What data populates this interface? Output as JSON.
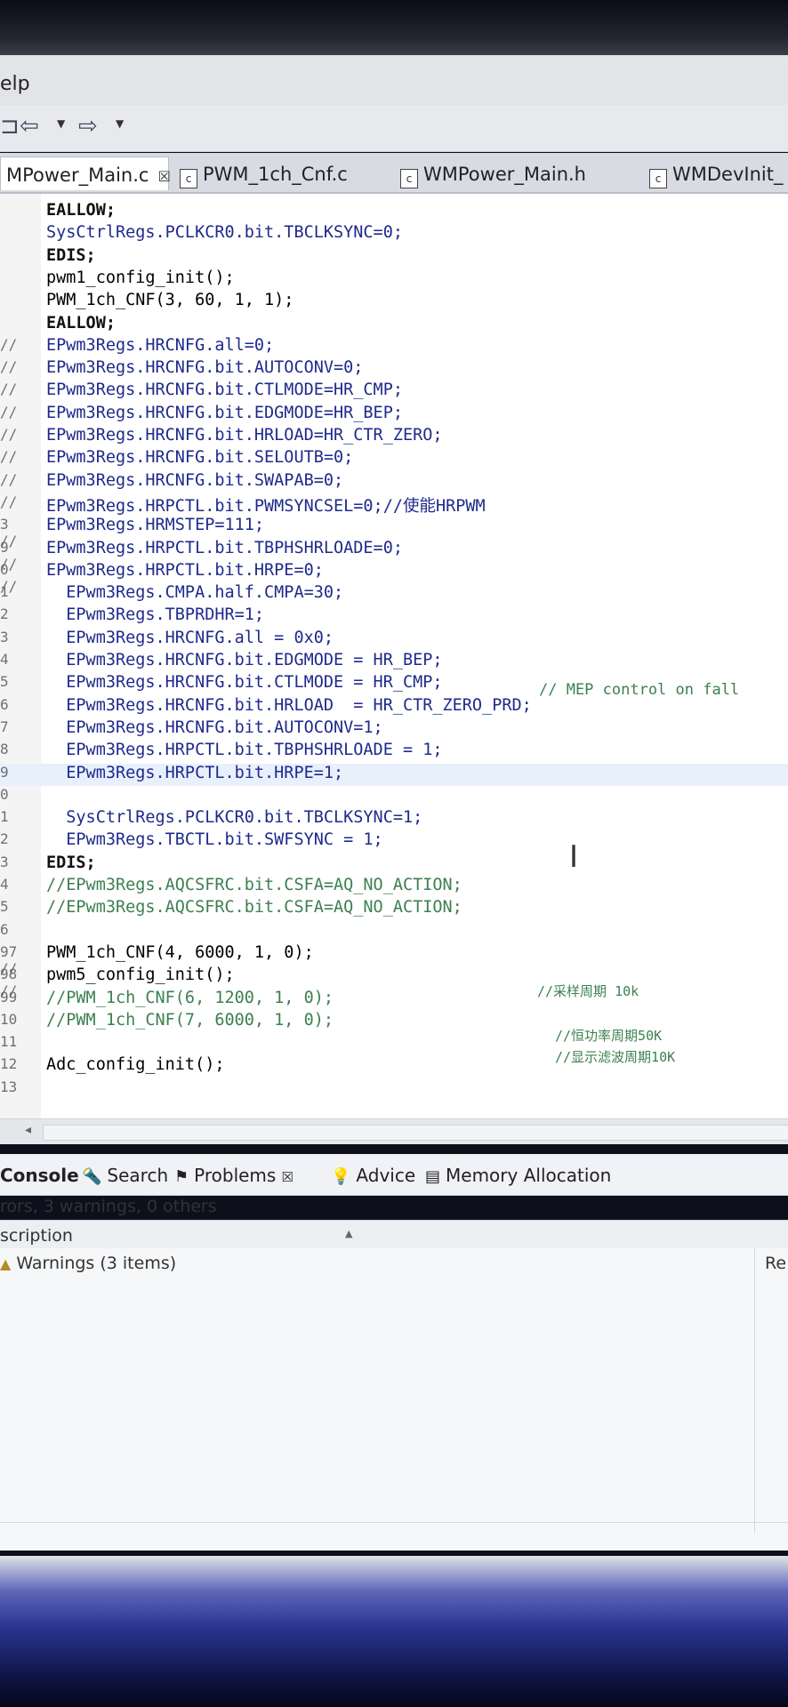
{
  "menubar": {
    "help_label": "elp"
  },
  "tabs": [
    {
      "label": "MPower_Main.c",
      "active": true,
      "close": "☒"
    },
    {
      "label": "PWM_1ch_Cnf.c",
      "icon": "c"
    },
    {
      "label": "WMPower_Main.h",
      "icon": "c"
    },
    {
      "label": "WMDevInit_",
      "icon": "c"
    }
  ],
  "editor": {
    "lines": [
      {
        "no": "",
        "code": "EALLOW;"
      },
      {
        "no": "",
        "code": "SysCtrlRegs.PCLKCR0.bit.TBCLKSYNC=0;"
      },
      {
        "no": "",
        "code": "EDIS;"
      },
      {
        "no": "",
        "code": "pwm1_config_init();"
      },
      {
        "no": "",
        "code": "PWM_1ch_CNF(3, 60, 1, 1);"
      },
      {
        "no": "",
        "code": "EALLOW;"
      },
      {
        "no": "//",
        "code": "EPwm3Regs.HRCNFG.all=0;"
      },
      {
        "no": "//",
        "code": "EPwm3Regs.HRCNFG.bit.AUTOCONV=0;"
      },
      {
        "no": "//",
        "code": "EPwm3Regs.HRCNFG.bit.CTLMODE=HR_CMP;"
      },
      {
        "no": "//",
        "code": "EPwm3Regs.HRCNFG.bit.EDGMODE=HR_BEP;"
      },
      {
        "no": "//",
        "code": "EPwm3Regs.HRCNFG.bit.HRLOAD=HR_CTR_ZERO;"
      },
      {
        "no": "//",
        "code": "EPwm3Regs.HRCNFG.bit.SELOUTB=0;"
      },
      {
        "no": "//",
        "code": "EPwm3Regs.HRCNFG.bit.SWAPAB=0;"
      },
      {
        "no": "//",
        "code": "EPwm3Regs.HRPCTL.bit.PWMSYNCSEL=0;//使能HRPWM"
      },
      {
        "no": "3 //",
        "code": "EPwm3Regs.HRMSTEP=111;"
      },
      {
        "no": "9 //",
        "code": "EPwm3Regs.HRPCTL.bit.TBPHSHRLOADE=0;"
      },
      {
        "no": "0 //",
        "code": "EPwm3Regs.HRPCTL.bit.HRPE=0;"
      },
      {
        "no": "1",
        "code": "  EPwm3Regs.CMPA.half.CMPA=30;"
      },
      {
        "no": "2",
        "code": "  EPwm3Regs.TBPRDHR=1;"
      },
      {
        "no": "3",
        "code": "  EPwm3Regs.HRCNFG.all = 0x0;"
      },
      {
        "no": "4",
        "code": "  EPwm3Regs.HRCNFG.bit.EDGMODE = HR_BEP;"
      },
      {
        "no": "5",
        "code": "  EPwm3Regs.HRCNFG.bit.CTLMODE = HR_CMP;"
      },
      {
        "no": "6",
        "code": "  EPwm3Regs.HRCNFG.bit.HRLOAD  = HR_CTR_ZERO_PRD;"
      },
      {
        "no": "7",
        "code": "  EPwm3Regs.HRCNFG.bit.AUTOCONV=1;"
      },
      {
        "no": "8",
        "code": "  EPwm3Regs.HRPCTL.bit.TBPHSHRLOADE = 1;"
      },
      {
        "no": "9",
        "code": "  EPwm3Regs.HRPCTL.bit.HRPE=1;"
      },
      {
        "no": "0",
        "code": ""
      },
      {
        "no": "1",
        "code": "  SysCtrlRegs.PCLKCR0.bit.TBCLKSYNC=1;"
      },
      {
        "no": "2",
        "code": "  EPwm3Regs.TBCTL.bit.SWFSYNC = 1;"
      },
      {
        "no": "3",
        "code": "EDIS;"
      },
      {
        "no": "4",
        "code": "//EPwm3Regs.AQCSFRC.bit.CSFA=AQ_NO_ACTION;"
      },
      {
        "no": "5",
        "code": "//EPwm3Regs.AQCSFRC.bit.CSFA=AQ_NO_ACTION;"
      },
      {
        "no": "6",
        "code": ""
      },
      {
        "no": "97 //",
        "code": "PWM_1ch_CNF(4, 6000, 1, 0);"
      },
      {
        "no": "98 //",
        "code": "pwm5_config_init();"
      },
      {
        "no": "99",
        "code": "//PWM_1ch_CNF(6, 1200, 1, 0);"
      },
      {
        "no": "10",
        "code": "//PWM_1ch_CNF(7, 6000, 1, 0);"
      },
      {
        "no": "11",
        "code": ""
      },
      {
        "no": "12",
        "code": "Adc_config_init();"
      },
      {
        "no": "13",
        "code": ""
      }
    ],
    "trailing_comments": {
      "mep": "// MEP control on fall",
      "c1": "//采样周期 10k",
      "c2": "//恒功率周期50K",
      "c3": "//显示滤波周期10K"
    }
  },
  "panel": {
    "tabs": [
      {
        "label": "Console",
        "icon": "console-icon"
      },
      {
        "label": "Search",
        "icon": "search-icon"
      },
      {
        "label": "Problems",
        "icon": "problems-icon"
      },
      {
        "label": "Advice",
        "icon": "lightbulb-icon"
      },
      {
        "label": "Memory Allocation",
        "icon": "memory-icon"
      }
    ],
    "summary": "rors, 3 warnings, 0 others",
    "column_description": "scription",
    "column_resource": "Re",
    "warnings_row": "Warnings (3 items)"
  }
}
